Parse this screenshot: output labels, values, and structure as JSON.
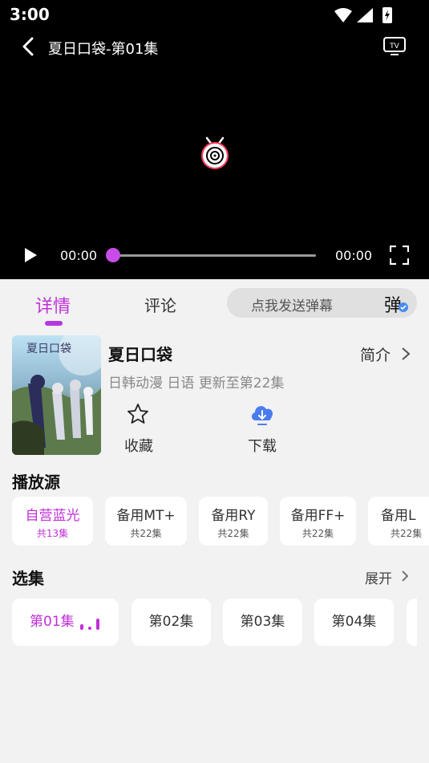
{
  "status_bar": {
    "time": "3:00"
  },
  "player": {
    "title": "夏日口袋-第01集",
    "current_time": "00:00",
    "total_time": "00:00",
    "progress": 0
  },
  "tabs": {
    "detail": "详情",
    "comments": "评论",
    "danmu_placeholder": "点我发送弹幕",
    "danmu_icon_char": "弹"
  },
  "anime": {
    "poster_text": "夏日口袋",
    "title": "夏日口袋",
    "meta": "日韩动漫 日语 更新至第22集",
    "intro_label": "简介",
    "favorite_label": "收藏",
    "download_label": "下载"
  },
  "sources": {
    "title": "播放源",
    "items": [
      {
        "name": "自营蓝光",
        "count": "共13集"
      },
      {
        "name": "备用MT+",
        "count": "共22集"
      },
      {
        "name": "备用RY",
        "count": "共22集"
      },
      {
        "name": "备用FF+",
        "count": "共22集"
      },
      {
        "name": "备用L",
        "count": "共22集"
      }
    ]
  },
  "episodes": {
    "title": "选集",
    "expand_label": "展开",
    "items": [
      "第01集",
      "第02集",
      "第03集",
      "第04集"
    ]
  },
  "colors": {
    "accent": "#c030d8",
    "download": "#4a7cf0"
  }
}
